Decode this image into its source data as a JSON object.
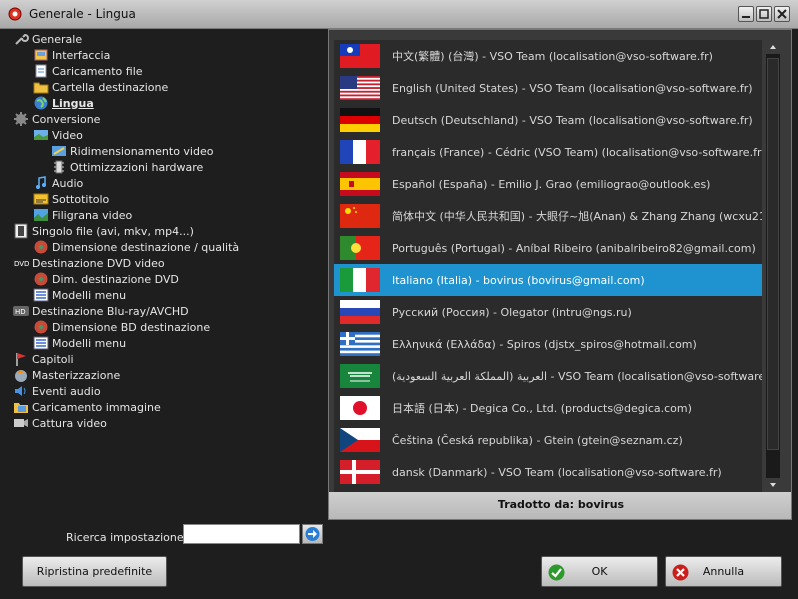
{
  "window": {
    "title": "Generale - Lingua"
  },
  "tree": [
    {
      "label": "Generale",
      "level": 0,
      "icon": "wrench-icon"
    },
    {
      "label": "Interfaccia",
      "level": 1,
      "icon": "interface-icon"
    },
    {
      "label": "Caricamento file",
      "level": 1,
      "icon": "file-load-icon"
    },
    {
      "label": "Cartella destinazione",
      "level": 1,
      "icon": "folder-icon"
    },
    {
      "label": "Lingua",
      "level": 1,
      "icon": "globe-icon",
      "selected": true
    },
    {
      "label": "Conversione",
      "level": 0,
      "icon": "gear-icon"
    },
    {
      "label": "Video",
      "level": 1,
      "icon": "video-icon"
    },
    {
      "label": "Ridimensionamento video",
      "level": 2,
      "icon": "resize-icon"
    },
    {
      "label": "Ottimizzazioni hardware",
      "level": 2,
      "icon": "chip-icon"
    },
    {
      "label": "Audio",
      "level": 1,
      "icon": "music-note-icon"
    },
    {
      "label": "Sottotitolo",
      "level": 1,
      "icon": "subtitle-icon"
    },
    {
      "label": "Filigrana video",
      "level": 1,
      "icon": "watermark-icon"
    },
    {
      "label": "Singolo file (avi, mkv, mp4...)",
      "level": 0,
      "icon": "film-icon"
    },
    {
      "label": "Dimensione destinazione / qualità",
      "level": 1,
      "icon": "disc-icon"
    },
    {
      "label": "Destinazione DVD video",
      "level": 0,
      "icon": "dvd-icon"
    },
    {
      "label": "Dim. destinazione DVD",
      "level": 1,
      "icon": "disc-icon"
    },
    {
      "label": "Modelli menu",
      "level": 1,
      "icon": "menu-template-icon"
    },
    {
      "label": "Destinazione Blu-ray/AVCHD",
      "level": 0,
      "icon": "hd-icon"
    },
    {
      "label": "Dimensione BD destinazione",
      "level": 1,
      "icon": "disc-icon"
    },
    {
      "label": "Modelli menu",
      "level": 1,
      "icon": "menu-template-icon"
    },
    {
      "label": "Capitoli",
      "level": 0,
      "icon": "flag-icon"
    },
    {
      "label": "Masterizzazione",
      "level": 0,
      "icon": "burn-icon"
    },
    {
      "label": "Eventi audio",
      "level": 0,
      "icon": "speaker-icon"
    },
    {
      "label": "Caricamento immagine",
      "level": 0,
      "icon": "image-folder-icon"
    },
    {
      "label": "Cattura video",
      "level": 0,
      "icon": "capture-icon"
    }
  ],
  "languages": [
    {
      "flag": "taiwan-flag-icon",
      "label": "中文(繁體) (台灣) - VSO Team (localisation@vso-software.fr)"
    },
    {
      "flag": "usa-flag-icon",
      "label": "English (United States) - VSO Team (localisation@vso-software.fr)"
    },
    {
      "flag": "germany-flag-icon",
      "label": "Deutsch (Deutschland) - VSO Team (localisation@vso-software.fr)"
    },
    {
      "flag": "france-flag-icon",
      "label": "français (France) - Cédric (VSO Team) (localisation@vso-software.fr)"
    },
    {
      "flag": "spain-flag-icon",
      "label": "Español (España) - Emilio J. Grao (emiliograo@outlook.es)"
    },
    {
      "flag": "china-flag-icon",
      "label": "简体中文 (中华人民共和国) - 大眼仔~旭(Anan) & Zhang Zhang (wcxu21@"
    },
    {
      "flag": "portugal-flag-icon",
      "label": "Português (Portugal) - Aníbal Ribeiro (anibalribeiro82@gmail.com)"
    },
    {
      "flag": "italy-flag-icon",
      "label": "Italiano (Italia) - bovirus (bovirus@gmail.com)",
      "selected": true
    },
    {
      "flag": "russia-flag-icon",
      "label": "Русский (Россия) - Olegator (intru@ngs.ru)"
    },
    {
      "flag": "greece-flag-icon",
      "label": "Ελληνικά (Ελλάδα) - Spiros (djstx_spiros@hotmail.com)"
    },
    {
      "flag": "saudi-flag-icon",
      "label": "(العربية (المملكة العربية السعودية - VSO Team (localisation@vso-software.fr)"
    },
    {
      "flag": "japan-flag-icon",
      "label": "日本語 (日本) - Degica Co., Ltd. (products@degica.com)"
    },
    {
      "flag": "czech-flag-icon",
      "label": "Čeština (Česká republika) - Gtein (gtein@seznam.cz)"
    },
    {
      "flag": "denmark-flag-icon",
      "label": "dansk (Danmark) - VSO Team (localisation@vso-software.fr)"
    }
  ],
  "translated_by": "Tradotto da: bovirus",
  "search": {
    "label": "Ricerca impostazione:",
    "value": ""
  },
  "buttons": {
    "reset": "Ripristina predefinite",
    "ok": "OK",
    "cancel": "Annulla"
  },
  "colors": {
    "selection": "#1e93d0",
    "background": "#1e1e1e"
  }
}
